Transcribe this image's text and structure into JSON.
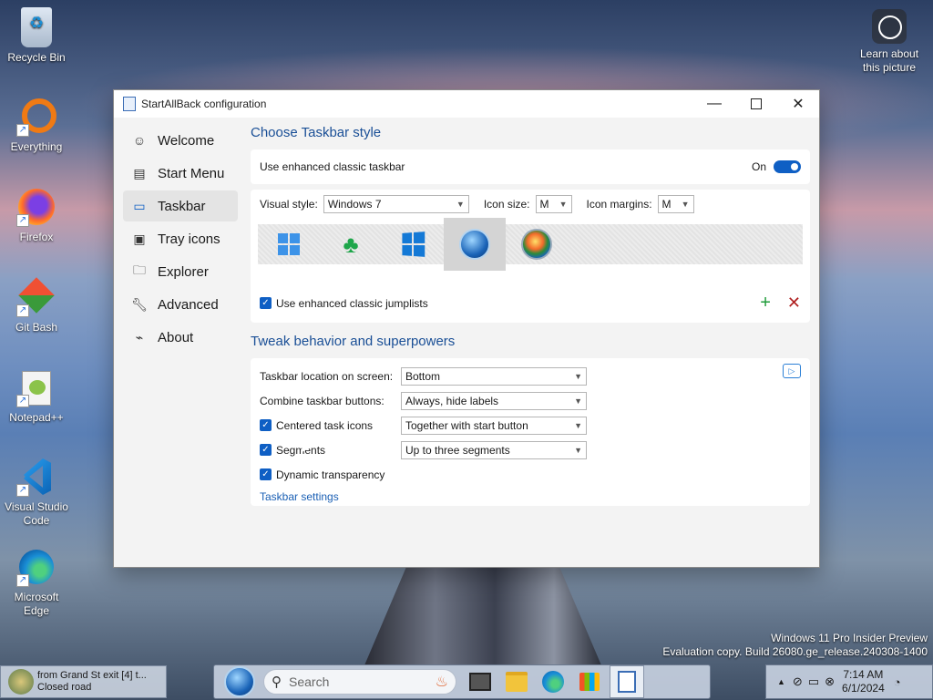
{
  "desktop": {
    "icons": [
      {
        "label": "Recycle Bin"
      },
      {
        "label": "Everything"
      },
      {
        "label": "Firefox"
      },
      {
        "label": "Git Bash"
      },
      {
        "label": "Notepad++"
      },
      {
        "label": "Visual Studio Code"
      },
      {
        "label": "Microsoft Edge"
      }
    ],
    "learn_picture": "Learn about this picture",
    "watermark_line1": "Windows 11 Pro Insider Preview",
    "watermark_line2": "Evaluation copy. Build 26080.ge_release.240308-1400"
  },
  "window": {
    "title": "StartAllBack configuration",
    "sidebar": [
      {
        "label": "Welcome",
        "icon": "smile-icon"
      },
      {
        "label": "Start Menu",
        "icon": "start-menu-icon"
      },
      {
        "label": "Taskbar",
        "icon": "taskbar-icon",
        "active": true
      },
      {
        "label": "Tray icons",
        "icon": "tray-icon"
      },
      {
        "label": "Explorer",
        "icon": "folder-icon"
      },
      {
        "label": "Advanced",
        "icon": "wrench-icon"
      },
      {
        "label": "About",
        "icon": "about-icon"
      }
    ],
    "taskbar_style": {
      "heading": "Choose Taskbar style",
      "enhanced_label": "Use enhanced classic taskbar",
      "toggle_state": "On",
      "visual_style_label": "Visual style:",
      "visual_style_value": "Windows 7",
      "icon_size_label": "Icon size:",
      "icon_size_value": "M",
      "icon_margins_label": "Icon margins:",
      "icon_margins_value": "M",
      "jumplists_label": "Use enhanced classic jumplists"
    },
    "tweak": {
      "heading": "Tweak behavior and superpowers",
      "location_label": "Taskbar location on screen:",
      "location_value": "Bottom",
      "combine_label": "Combine taskbar buttons:",
      "combine_value": "Always, hide labels",
      "centered_label": "Centered task icons",
      "centered_value": "Together with start button",
      "segments_label": "Segments",
      "segments_value": "Up to three segments",
      "transparency_label": "Dynamic transparency",
      "settings_link": "Taskbar settings"
    }
  },
  "taskbar": {
    "left_title": "from Grand St exit [4] t...",
    "left_subtitle": "Closed road",
    "search_placeholder": "Search",
    "time": "7:14 AM",
    "date": "6/1/2024",
    "colors": {
      "accent": "#0f5fc4",
      "heading": "#1a4f96"
    }
  }
}
